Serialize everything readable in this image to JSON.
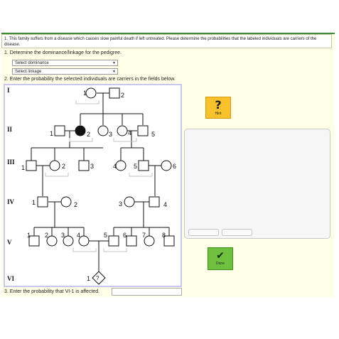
{
  "question": {
    "text": "1. This family suffers from a disease which causes slow painful death if left untreated. Please determine the probabilities that the labeled individuals are carriers of the disease."
  },
  "step1": {
    "label": "1. Determine the dominance/linkage for the pedigree."
  },
  "selects": {
    "dominance": "Select dominance",
    "linkage": "Select linkage"
  },
  "step2": {
    "label": "2. Enter the probability the selected individuals are carriers in the fields below."
  },
  "generations": [
    "I",
    "II",
    "III",
    "IV",
    "V",
    "VI"
  ],
  "pedigree_labels": {
    "I1": "1",
    "I2": "2",
    "II1": "1",
    "II2": "2",
    "II3": "3",
    "II4": "4",
    "II5": "5",
    "III1": "1",
    "III2": "2",
    "III3": "3",
    "III4": "4",
    "III5": "5",
    "III6": "6",
    "IV1": "1",
    "IV2": "2",
    "IV3": "3",
    "IV4": "4",
    "V1": "1",
    "V2": "2",
    "V3": "3",
    "V4": "4",
    "V5": "5",
    "V6": "6",
    "V7": "7",
    "V8": "8",
    "VI1": "1",
    "VI1_mark": "?"
  },
  "hint": {
    "icon": "?",
    "label": "Hint"
  },
  "done": {
    "icon": "✔",
    "label": "Done"
  },
  "step3": {
    "label": "3. Enter the probability that VI-1 is affected."
  },
  "colors": {
    "accent_green": "#3a8a3a",
    "hint_bg": "#f9c22c",
    "done_bg": "#6fc13f",
    "panel_bg": "#ffffe8"
  }
}
